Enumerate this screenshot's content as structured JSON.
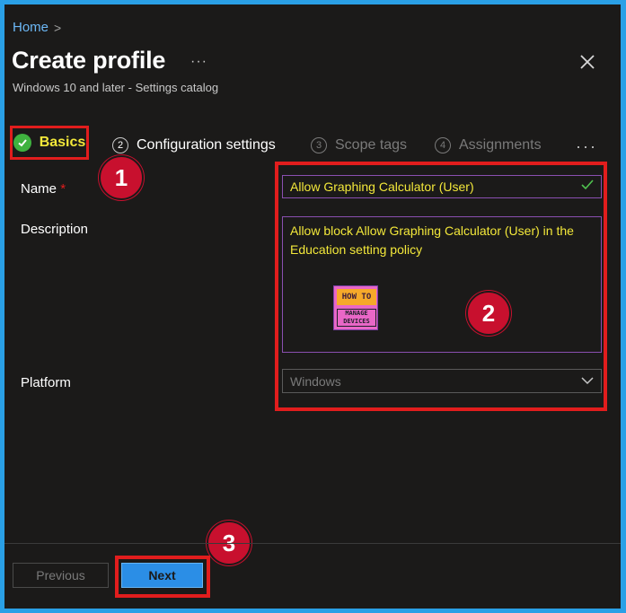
{
  "breadcrumb": {
    "home": "Home",
    "separator": ">"
  },
  "header": {
    "title": "Create profile",
    "more": "···",
    "subtitle": "Windows 10 and later - Settings catalog"
  },
  "tabs": [
    {
      "label": "Basics",
      "number": "",
      "state": "active-complete"
    },
    {
      "label": "Configuration settings",
      "number": "2",
      "state": "enabled"
    },
    {
      "label": "Scope tags",
      "number": "3",
      "state": "disabled"
    },
    {
      "label": "Assignments",
      "number": "4",
      "state": "disabled"
    }
  ],
  "tabs_more": "···",
  "form": {
    "name_label": "Name",
    "required_mark": "*",
    "name_value": "Allow Graphing Calculator (User)",
    "description_label": "Description",
    "description_value": "Allow block Allow Graphing Calculator (User) in the Education setting policy",
    "platform_label": "Platform",
    "platform_value": "Windows"
  },
  "logo": {
    "line1": "HOW TO",
    "line2": "MANAGE",
    "line3": "DEVICES"
  },
  "markers": [
    "1",
    "2",
    "3"
  ],
  "footer": {
    "previous": "Previous",
    "next": "Next"
  },
  "colors": {
    "accent": "#2b8ee6",
    "highlight": "#f3e83a",
    "annotation_red": "#e11d1d",
    "check_green": "#3fb23f",
    "background": "#1b1a19"
  }
}
